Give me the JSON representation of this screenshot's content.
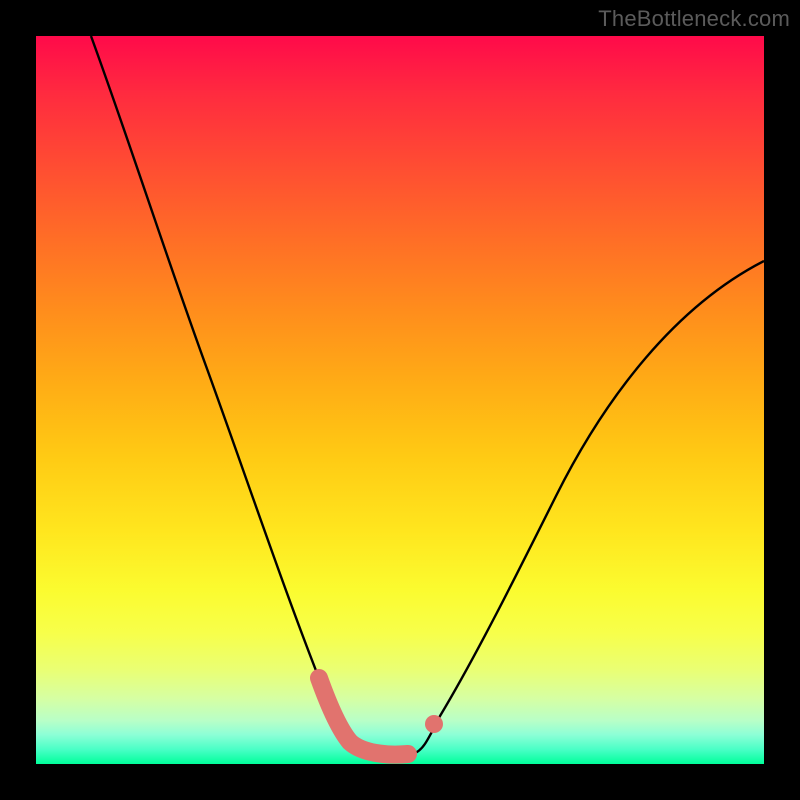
{
  "watermark": "TheBottleneck.com",
  "chart_data": {
    "type": "line",
    "title": "",
    "xlabel": "",
    "ylabel": "",
    "xlim": [
      0,
      100
    ],
    "ylim": [
      0,
      100
    ],
    "series": [
      {
        "name": "black-curve",
        "color": "#000000",
        "x": [
          8,
          12,
          16,
          20,
          24,
          28,
          32,
          36,
          38,
          40,
          42,
          44,
          46,
          48,
          50,
          52,
          54,
          58,
          62,
          66,
          70,
          74,
          78,
          82,
          86,
          90,
          94,
          98,
          100
        ],
        "values": [
          100,
          87,
          75,
          63,
          52,
          42,
          33,
          24,
          20,
          16,
          12,
          8,
          5,
          3,
          2,
          2,
          2,
          4,
          8,
          14,
          21,
          28,
          35,
          42,
          49,
          55,
          61,
          66,
          69
        ]
      },
      {
        "name": "pink-highlight",
        "color": "#e1736e",
        "x": [
          40,
          42,
          44,
          46,
          48,
          50,
          52,
          54
        ],
        "values": [
          14,
          9,
          5,
          3,
          2,
          2,
          2,
          4
        ]
      }
    ],
    "highlight_gap": {
      "x": 54,
      "y": 5
    }
  }
}
